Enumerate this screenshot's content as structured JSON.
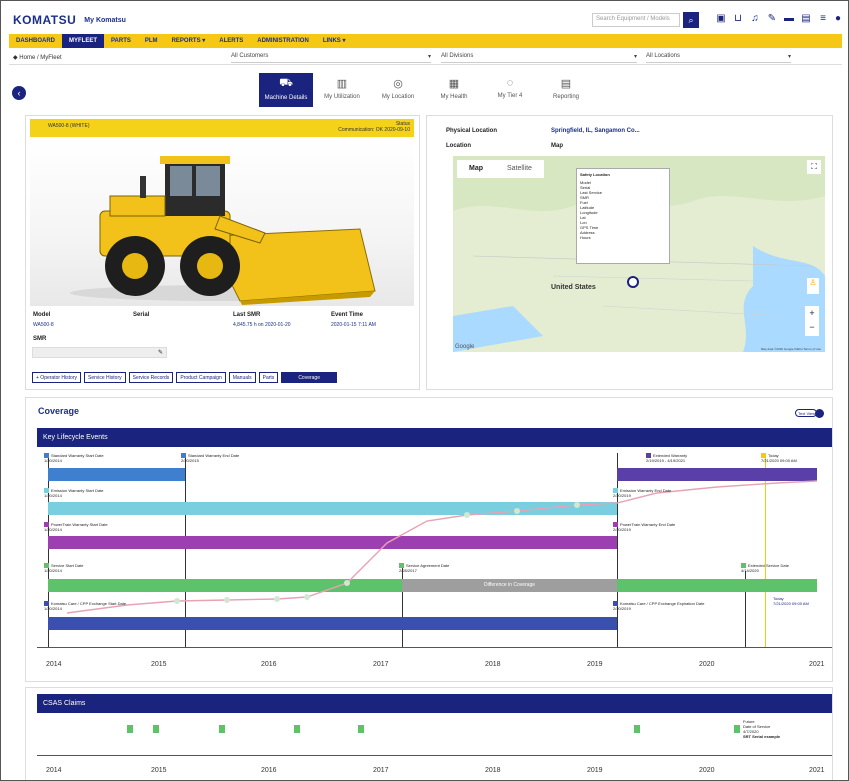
{
  "header": {
    "logo": "KOMATSU",
    "app_name": "My Komatsu",
    "search_placeholder": "Search Equipment / Models",
    "icons": [
      "search-icon",
      "clipboard-icon",
      "cart-icon",
      "bell-icon",
      "pen-icon",
      "folder-icon",
      "message-icon",
      "user-icon"
    ]
  },
  "nav": {
    "items": [
      "DASHBOARD",
      "MYFLEET",
      "PARTS",
      "PLM",
      "REPORTS ▾",
      "ALERTS",
      "ADMINISTRATION",
      "LINKS ▾"
    ],
    "active_index": 1
  },
  "subbar": {
    "breadcrumb": "◆ Home / MyFleet",
    "filter1": "All Customers",
    "filter2": "All Divisions",
    "filter3": "All Locations"
  },
  "tabs": [
    {
      "label": "Machine Details",
      "icon": "loader-icon"
    },
    {
      "label": "My Utilization",
      "icon": "chart-icon"
    },
    {
      "label": "My Location",
      "icon": "pin-icon"
    },
    {
      "label": "My Health",
      "icon": "health-icon"
    },
    {
      "label": "My Tier 4",
      "icon": "leaf-icon"
    },
    {
      "label": "Reporting",
      "icon": "report-icon"
    }
  ],
  "machine": {
    "title": "WA500-8 (WHITE)",
    "status_line1": "Status",
    "status_line2": "Communication: OK  2020-09-10",
    "fields": [
      {
        "k": "Model",
        "v": "WA500-8"
      },
      {
        "k": "Serial",
        "v": ""
      },
      {
        "k": "Last SMR",
        "v": "4,845.75 h on 2020-01-20"
      },
      {
        "k": "Event Time",
        "v": "2020-01-15 7:11 AM"
      }
    ],
    "smr_label": "SMR",
    "buttons": [
      "+ Operator History",
      "Service History",
      "Service Records",
      "Product Campaign",
      "Manuals",
      "Parts"
    ],
    "primary_button": "Coverage"
  },
  "location": {
    "physical_label": "Physical Location",
    "physical_value": "Springfield, IL, Sangamon Co...",
    "location_label": "Location",
    "location_value": "Map",
    "map_tabs": [
      "Map",
      "Satellite"
    ],
    "country_label": "United States",
    "popup_title": "Safety Location",
    "popup_lines": [
      "Model",
      "Serial",
      "Last Service",
      "SMR",
      "Fuel",
      "Latitude",
      "Longitude",
      "Lat",
      "Lon",
      "GPS Time",
      "Address",
      "Hours"
    ],
    "attribution": "Map data ©2020 Google INEGI   Terms of Use",
    "google": "Google"
  },
  "coverage": {
    "title": "Coverage",
    "toggle_label": "Text View",
    "band_title": "Key Lifecycle Events",
    "events": [
      {
        "label": "Standard Warranty Start Date",
        "date": "1/20/2014",
        "color": "#3f7fd0"
      },
      {
        "label": "Standard Warranty End Date",
        "date": "2/20/2015",
        "color": "#3f7fd0"
      },
      {
        "label": "Extended Warranty",
        "date": "2/19/2019 - 4/19/2021",
        "color": "#5b3fa8"
      },
      {
        "label": "Today",
        "date": "7/21/2020 09:00 AM",
        "color": "#f4c814"
      },
      {
        "label": "Emission Warranty Start Date",
        "date": "1/20/2014",
        "color": "#79cfe0"
      },
      {
        "label": "Emission Warranty End Date",
        "date": "2/20/2019",
        "color": "#79cfe0"
      },
      {
        "label": "PowerTrain Warranty Start Date",
        "date": "1/20/2014",
        "color": "#9c3fb0"
      },
      {
        "label": "PowerTrain Warranty End Date",
        "date": "2/20/2019",
        "color": "#9c3fb0"
      },
      {
        "label": "Service Start Date",
        "date": "1/20/2014",
        "color": "#5dc26b"
      },
      {
        "label": "Service Agreement Date",
        "date": "2/28/2017",
        "color": "#5dc26b"
      },
      {
        "label": "Extended Service Date",
        "date": "4/14/2020",
        "color": "#5dc26b"
      },
      {
        "label": "Komatsu Care / CPP Exchange Start Date",
        "date": "1/20/2014",
        "color": "#3a4fb0"
      },
      {
        "label": "Komatsu Care / CPP Exchange Expiration Date",
        "date": "2/20/2019",
        "color": "#3a4fb0"
      },
      {
        "label": "Today",
        "date": "7/21/2020 09:00 AM",
        "color": "#1a237e"
      }
    ],
    "gap_label": "Difference in Coverage",
    "years": [
      "2014",
      "2015",
      "2016",
      "2017",
      "2018",
      "2019",
      "2020",
      "2021"
    ]
  },
  "claims": {
    "band_title": "CSAS Claims",
    "note_lines": [
      "Future",
      "Date of Service",
      "4/7/2020",
      "SRT Serial example"
    ],
    "years": [
      "2014",
      "2015",
      "2016",
      "2017",
      "2018",
      "2019",
      "2020",
      "2021"
    ]
  }
}
